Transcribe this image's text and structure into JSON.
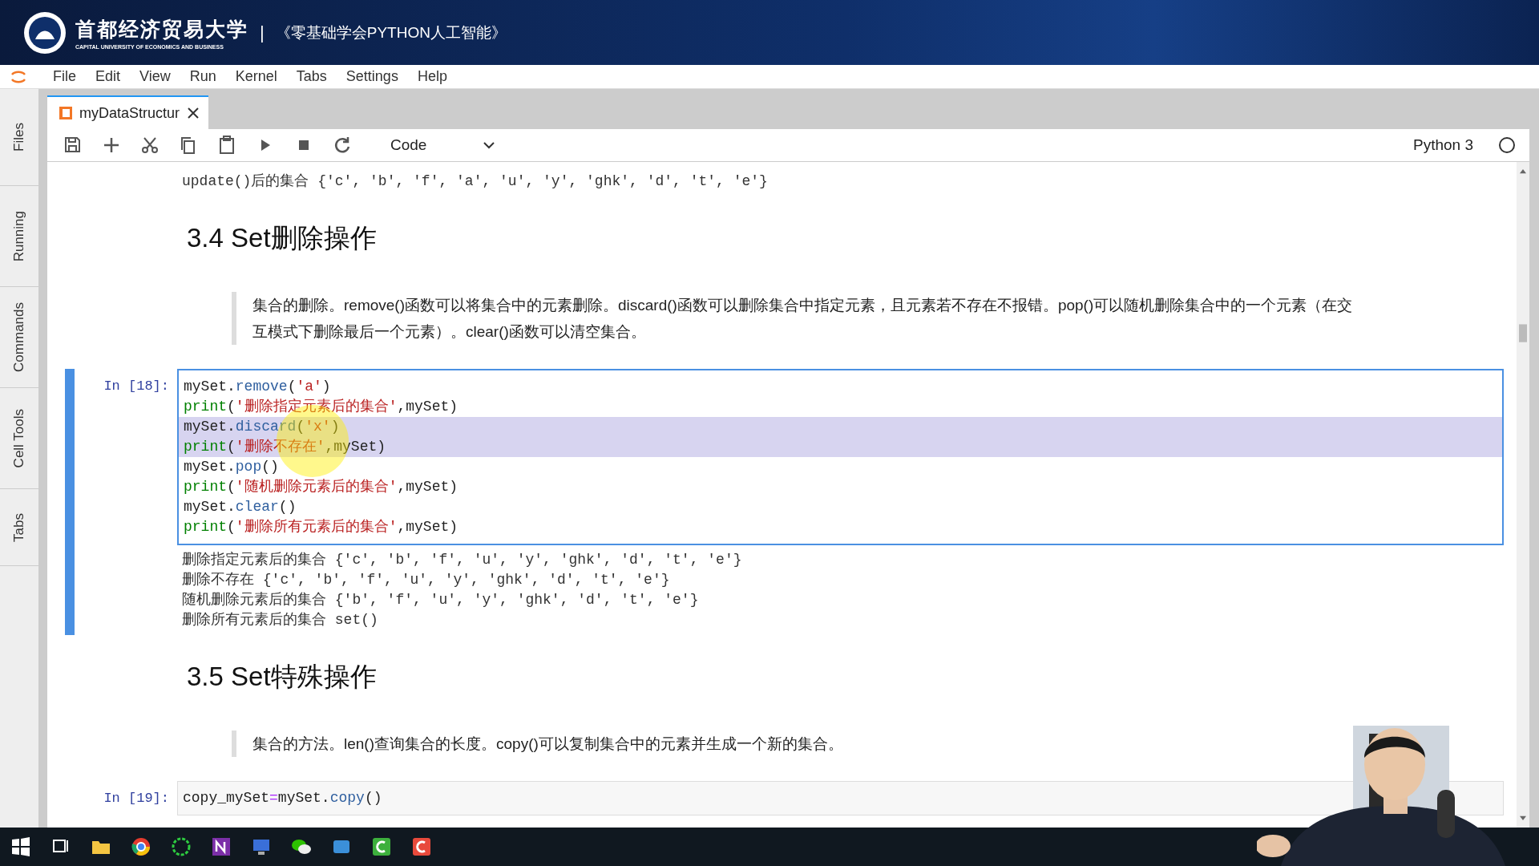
{
  "banner": {
    "university": "首都经济贸易大学",
    "university_en": "CAPITAL UNIVERSITY OF ECONOMICS AND BUSINESS",
    "separator": "|",
    "course": "《零基础学会PYTHON人工智能》"
  },
  "menu": [
    "File",
    "Edit",
    "View",
    "Run",
    "Kernel",
    "Tabs",
    "Settings",
    "Help"
  ],
  "sidebar": [
    {
      "label": "Files",
      "selected": false
    },
    {
      "label": "Running",
      "selected": false
    },
    {
      "label": "Commands",
      "selected": false
    },
    {
      "label": "Cell Tools",
      "selected": false
    },
    {
      "label": "Tabs",
      "selected": false
    }
  ],
  "tabs": [
    {
      "label": "myDataStructur",
      "selected": true
    }
  ],
  "toolbar": {
    "cell_type": "Code",
    "kernel": "Python 3"
  },
  "cells": [
    {
      "kind": "output",
      "lines": [
        "update()后的集合 {'c', 'b', 'f', 'a', 'u', 'y', 'ghk', 'd', 't', 'e'}"
      ]
    },
    {
      "kind": "heading",
      "text": "3.4 Set删除操作"
    },
    {
      "kind": "quote",
      "text": "集合的删除。remove()函数可以将集合中的元素删除。discard()函数可以删除集合中指定元素，且元素若不存在不报错。pop()可以随机删除集合中的一个元素（在交互模式下删除最后一个元素）。clear()函数可以清空集合。"
    },
    {
      "kind": "code",
      "prompt": "In [18]:",
      "active": true,
      "lines": [
        {
          "selected": false,
          "tokens": [
            {
              "t": "mySet.",
              "kind": "name"
            },
            {
              "t": "remove",
              "kind": "method"
            },
            {
              "t": "(",
              "kind": "name"
            },
            {
              "t": "'a'",
              "kind": "string"
            },
            {
              "t": ")",
              "kind": "name"
            }
          ]
        },
        {
          "selected": false,
          "tokens": [
            {
              "t": "print",
              "kind": "builtin"
            },
            {
              "t": "(",
              "kind": "name"
            },
            {
              "t": "'删除指定元素后的集合'",
              "kind": "string"
            },
            {
              "t": ",mySet)",
              "kind": "name"
            }
          ]
        },
        {
          "selected": true,
          "tokens": [
            {
              "t": "mySet.",
              "kind": "name"
            },
            {
              "t": "discard",
              "kind": "method"
            },
            {
              "t": "(",
              "kind": "name"
            },
            {
              "t": "'x'",
              "kind": "string"
            },
            {
              "t": ")",
              "kind": "name"
            }
          ]
        },
        {
          "selected": true,
          "tokens": [
            {
              "t": "print",
              "kind": "builtin"
            },
            {
              "t": "(",
              "kind": "name"
            },
            {
              "t": "'删除不存在'",
              "kind": "string"
            },
            {
              "t": ",mySet)",
              "kind": "name"
            }
          ]
        },
        {
          "selected": false,
          "tokens": [
            {
              "t": "mySet.",
              "kind": "name"
            },
            {
              "t": "pop",
              "kind": "method"
            },
            {
              "t": "()",
              "kind": "name"
            }
          ]
        },
        {
          "selected": false,
          "tokens": [
            {
              "t": "print",
              "kind": "builtin"
            },
            {
              "t": "(",
              "kind": "name"
            },
            {
              "t": "'随机删除元素后的集合'",
              "kind": "string"
            },
            {
              "t": ",mySet)",
              "kind": "name"
            }
          ]
        },
        {
          "selected": false,
          "tokens": [
            {
              "t": "mySet.",
              "kind": "name"
            },
            {
              "t": "clear",
              "kind": "method"
            },
            {
              "t": "()",
              "kind": "name"
            }
          ]
        },
        {
          "selected": false,
          "tokens": [
            {
              "t": "print",
              "kind": "builtin"
            },
            {
              "t": "(",
              "kind": "name"
            },
            {
              "t": "'删除所有元素后的集合'",
              "kind": "string"
            },
            {
              "t": ",mySet)",
              "kind": "name"
            }
          ]
        }
      ]
    },
    {
      "kind": "output",
      "active": true,
      "lines": [
        "删除指定元素后的集合 {'c', 'b', 'f', 'u', 'y', 'ghk', 'd', 't', 'e'}",
        "删除不存在 {'c', 'b', 'f', 'u', 'y', 'ghk', 'd', 't', 'e'}",
        "随机删除元素后的集合 {'b', 'f', 'u', 'y', 'ghk', 'd', 't', 'e'}",
        "删除所有元素后的集合 set()"
      ]
    },
    {
      "kind": "heading",
      "text": "3.5 Set特殊操作"
    },
    {
      "kind": "quote",
      "text": "集合的方法。len()查询集合的长度。copy()可以复制集合中的元素并生成一个新的集合。"
    },
    {
      "kind": "code",
      "prompt": "In [19]:",
      "active": false,
      "lines": [
        {
          "selected": false,
          "tokens": [
            {
              "t": "copy_mySet",
              "kind": "name"
            },
            {
              "t": "=",
              "kind": "operator"
            },
            {
              "t": "mySet.",
              "kind": "name"
            },
            {
              "t": "copy",
              "kind": "method"
            },
            {
              "t": "()",
              "kind": "name"
            }
          ]
        }
      ]
    }
  ]
}
